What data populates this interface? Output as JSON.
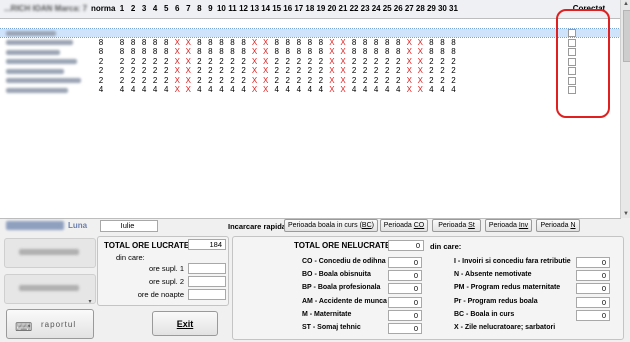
{
  "grid": {
    "header": {
      "name": "...RICH IOAN Marca: 7",
      "norma": "norma",
      "days": [
        "1",
        "2",
        "3",
        "4",
        "5",
        "6",
        "7",
        "8",
        "9",
        "10",
        "11",
        "12",
        "13",
        "14",
        "15",
        "16",
        "17",
        "18",
        "19",
        "20",
        "21",
        "22",
        "23",
        "24",
        "25",
        "26",
        "27",
        "28",
        "29",
        "30",
        "31"
      ],
      "correctat": "Corectat"
    },
    "rows": [
      {
        "norma": "",
        "cells": [
          "",
          "",
          "",
          "",
          "",
          "",
          "",
          "",
          "",
          "",
          "",
          "",
          "",
          "",
          "",
          "",
          "",
          "",
          "",
          "",
          "",
          "",
          "",
          "",
          "",
          "",
          "",
          "",
          "",
          "",
          ""
        ],
        "selected": true
      },
      {
        "norma": "8",
        "cells": [
          "8",
          "8",
          "8",
          "8",
          "8",
          "X",
          "X",
          "8",
          "8",
          "8",
          "8",
          "8",
          "X",
          "X",
          "8",
          "8",
          "8",
          "8",
          "8",
          "X",
          "X",
          "8",
          "8",
          "8",
          "8",
          "8",
          "X",
          "X",
          "8",
          "8",
          "8"
        ]
      },
      {
        "norma": "8",
        "cells": [
          "8",
          "8",
          "8",
          "8",
          "8",
          "X",
          "X",
          "8",
          "8",
          "8",
          "8",
          "8",
          "X",
          "X",
          "8",
          "8",
          "8",
          "8",
          "8",
          "X",
          "X",
          "8",
          "8",
          "8",
          "8",
          "8",
          "X",
          "X",
          "8",
          "8",
          "8"
        ]
      },
      {
        "norma": "2",
        "cells": [
          "2",
          "2",
          "2",
          "2",
          "2",
          "X",
          "X",
          "2",
          "2",
          "2",
          "2",
          "2",
          "X",
          "X",
          "2",
          "2",
          "2",
          "2",
          "2",
          "X",
          "X",
          "2",
          "2",
          "2",
          "2",
          "2",
          "X",
          "X",
          "2",
          "2",
          "2"
        ]
      },
      {
        "norma": "2",
        "cells": [
          "2",
          "2",
          "2",
          "2",
          "2",
          "X",
          "X",
          "2",
          "2",
          "2",
          "2",
          "2",
          "X",
          "X",
          "2",
          "2",
          "2",
          "2",
          "2",
          "X",
          "X",
          "2",
          "2",
          "2",
          "2",
          "2",
          "X",
          "X",
          "2",
          "2",
          "2"
        ]
      },
      {
        "norma": "2",
        "cells": [
          "2",
          "2",
          "2",
          "2",
          "2",
          "X",
          "X",
          "2",
          "2",
          "2",
          "2",
          "2",
          "X",
          "X",
          "2",
          "2",
          "2",
          "2",
          "2",
          "X",
          "X",
          "2",
          "2",
          "2",
          "2",
          "2",
          "X",
          "X",
          "2",
          "2",
          "2"
        ]
      },
      {
        "norma": "4",
        "cells": [
          "4",
          "4",
          "4",
          "4",
          "4",
          "X",
          "X",
          "4",
          "4",
          "4",
          "4",
          "4",
          "X",
          "X",
          "4",
          "4",
          "4",
          "4",
          "4",
          "X",
          "X",
          "4",
          "4",
          "4",
          "4",
          "4",
          "X",
          "X",
          "4",
          "4",
          "4"
        ]
      }
    ]
  },
  "luna": {
    "label": "Luna",
    "value": "Iulie"
  },
  "incarcare": {
    "label": "Incarcare rapida :",
    "buttons": [
      {
        "pre": "Perioada boala in curs (",
        "key": "BC",
        "post": ")"
      },
      {
        "pre": "Perioada ",
        "key": "CO",
        "post": ""
      },
      {
        "pre": "Perioada ",
        "key": "St",
        "post": ""
      },
      {
        "pre": "Perioada ",
        "key": "Inv",
        "post": ""
      },
      {
        "pre": "Perioada ",
        "key": "N",
        "post": ""
      }
    ]
  },
  "lucrate": {
    "title": "TOTAL ORE LUCRATE",
    "total": "184",
    "din_care": "din care:",
    "items": [
      {
        "label": "ore supl. 1",
        "value": ""
      },
      {
        "label": "ore supl. 2",
        "value": ""
      },
      {
        "label": "ore de noapte",
        "value": ""
      }
    ]
  },
  "nelucrate": {
    "title": "TOTAL ORE NELUCRATE",
    "total": "0",
    "din_care": "din care:",
    "left": [
      {
        "label": "CO - Concediu de odihna",
        "value": "0"
      },
      {
        "label": "BO - Boala obisnuita",
        "value": "0"
      },
      {
        "label": "BP - Boala profesionala",
        "value": "0"
      },
      {
        "label": "AM - Accidente de munca",
        "value": "0"
      },
      {
        "label": "M  - Maternitate",
        "value": "0"
      },
      {
        "label": "ST - Somaj tehnic",
        "value": "0"
      }
    ],
    "right": [
      {
        "label": "I  - Invoiri si concediu fara retributie",
        "value": "0"
      },
      {
        "label": "N  - Absente nemotivate",
        "value": "0"
      },
      {
        "label": "PM  - Program redus maternitate",
        "value": "0"
      },
      {
        "label": "Pr  - Program redus boala",
        "value": "0"
      },
      {
        "label": "BC  - Boala in curs",
        "value": "0"
      },
      {
        "label": "X  - Zile nelucratoare; sarbatori",
        "value": ""
      }
    ]
  },
  "buttons": {
    "raport": "raportul",
    "exit": "Exit"
  },
  "colors": {
    "x_mark": "#e02020",
    "highlight_ring": "#e02020",
    "selected_row": "#cfe3fb"
  }
}
